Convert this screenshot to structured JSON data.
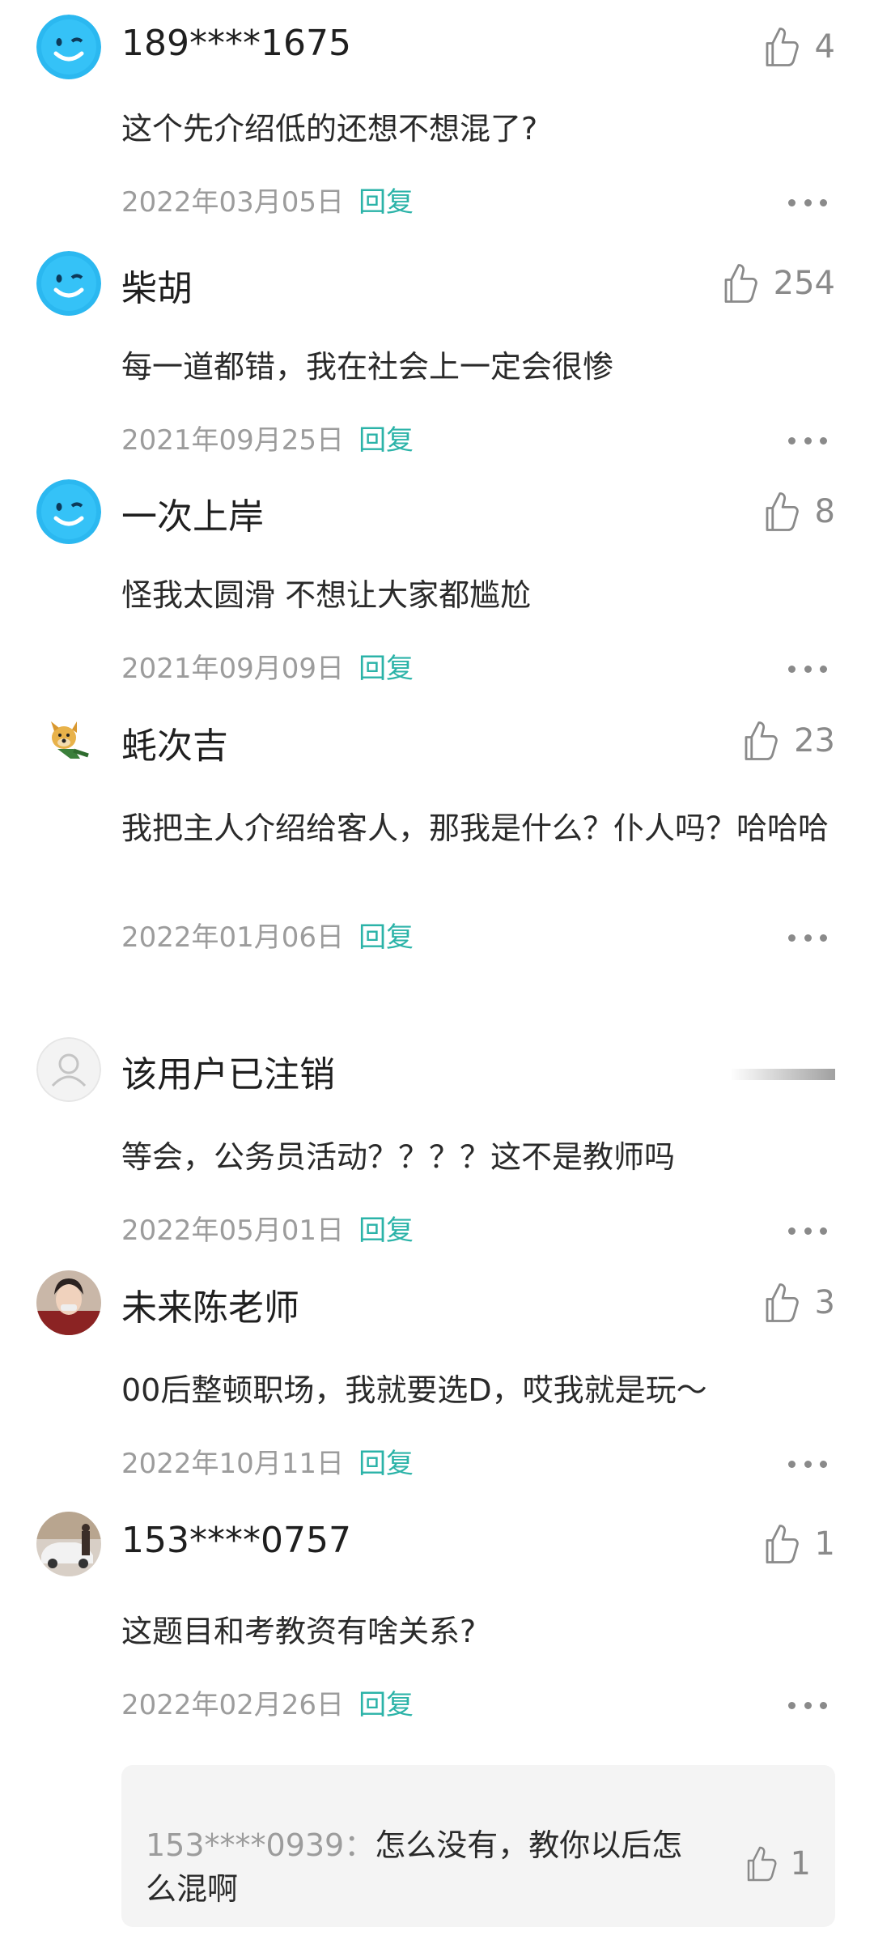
{
  "comments": [
    {
      "user": "189****1675",
      "avatar": "smiley-avatar",
      "likes": "4",
      "text": "这个先介绍低的还想不想混了?",
      "date": "2022年03月05日",
      "reply": "回复"
    },
    {
      "user": "柴胡",
      "avatar": "smiley-avatar",
      "likes": "254",
      "text": "每一道都错，我在社会上一定会很惨",
      "date": "2021年09月25日",
      "reply": "回复"
    },
    {
      "user": "一次上岸",
      "avatar": "smiley-avatar",
      "likes": "8",
      "text": "怪我太圆滑 不想让大家都尴尬",
      "date": "2021年09月09日",
      "reply": "回复"
    },
    {
      "user": "蚝次吉",
      "avatar": "doge-avatar",
      "likes": "23",
      "text": "我把主人介绍给客人，那我是什么？仆人吗？哈哈哈",
      "date": "2022年01月06日",
      "reply": "回复"
    },
    {
      "user": "该用户已注销",
      "avatar": "default-person-avatar",
      "likes": "",
      "text": "等会，公务员活动？？？？这不是教师吗",
      "date": "2022年05月01日",
      "reply": "回复"
    },
    {
      "user": "未来陈老师",
      "avatar": "photo-avatar",
      "likes": "3",
      "text": "00后整顿职场，我就要选D，哎我就是玩～",
      "date": "2022年10月11日",
      "reply": "回复"
    },
    {
      "user": "153****0757",
      "avatar": "car-photo-avatar",
      "likes": "1",
      "text": "这题目和考教资有啥关系?",
      "date": "2022年02月26日",
      "reply": "回复"
    }
  ],
  "subreply": {
    "user": "153****0939：",
    "text": "怎么没有，教你以后怎么混啊",
    "likes": "1"
  },
  "colors": {
    "accent": "#2bb3a8",
    "muted": "#9c9c9c",
    "icon": "#8a8a8a",
    "avatar_blue": "#29b6f6"
  }
}
